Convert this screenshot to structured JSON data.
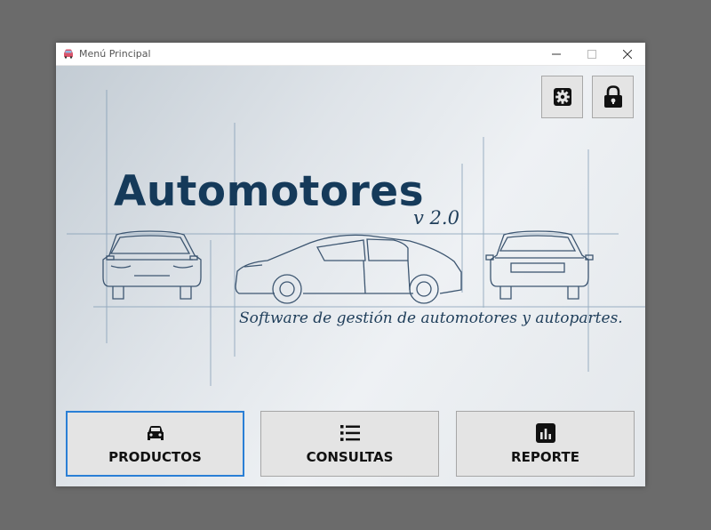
{
  "window": {
    "title": "Menú Principal",
    "controls": {
      "minimize": "—",
      "maximize": "☐",
      "close": "✕"
    }
  },
  "top_buttons": [
    {
      "name": "settings",
      "icon": "gear-icon"
    },
    {
      "name": "lock",
      "icon": "lock-icon"
    }
  ],
  "hero": {
    "title": "Automotores",
    "version": "v 2.0",
    "tagline": "Software de gestión de automotores y autopartes."
  },
  "nav": [
    {
      "label": "PRODUCTOS",
      "icon": "car-icon",
      "active": true
    },
    {
      "label": "CONSULTAS",
      "icon": "list-icon",
      "active": false
    },
    {
      "label": "REPORTE",
      "icon": "bar-chart-icon",
      "active": false
    }
  ],
  "colors": {
    "brand": "#153a5a",
    "focus": "#2a7fd6",
    "button": "#e4e4e4"
  }
}
